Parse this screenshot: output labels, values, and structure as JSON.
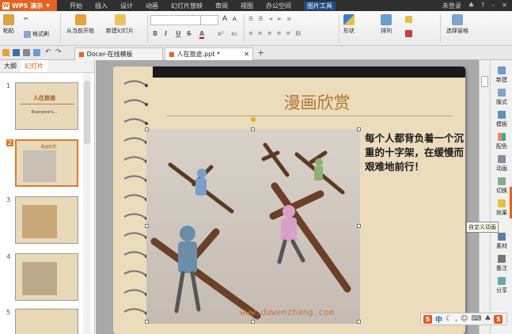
{
  "app": {
    "name": "WPS 演示"
  },
  "menu": [
    "开始",
    "插入",
    "设计",
    "动画",
    "幻灯片放映",
    "审阅",
    "视图",
    "办公空间",
    "图片工具"
  ],
  "menu_active": "图片工具",
  "login": "未登录",
  "ribbon": {
    "paste": "粘贴",
    "format_painter": "格式刷",
    "from_current": "从当前开始",
    "new_slide": "新建幻灯片",
    "shape": "形状",
    "arrange": "排列",
    "select_pane": "选择窗格"
  },
  "tabs": [
    {
      "label": "Docer-在线模板"
    },
    {
      "label": "人在旅途.ppt *"
    }
  ],
  "left_pane": {
    "tabs": [
      "大纲",
      "幻灯片"
    ],
    "active_tab": "幻灯片",
    "slides": [
      {
        "num": "1",
        "title": "人在旅途",
        "subtitle": "Everyone's..."
      },
      {
        "num": "2",
        "title": "漫画欣赏"
      },
      {
        "num": "3"
      },
      {
        "num": "4"
      },
      {
        "num": "5"
      }
    ]
  },
  "slide": {
    "title": "漫画欣赏",
    "caption": "每个人都背负着一个沉重的十字架，在缓慢而艰难地前行！",
    "watermark": "www.duwenzhang.com"
  },
  "right_panel": [
    "新建",
    "版式",
    "模板",
    "配色",
    "动画",
    "切换",
    "效果",
    "素材",
    "备注",
    "分享"
  ],
  "tooltip": "自定义动画",
  "ime": {
    "lang": "中"
  },
  "colors": {
    "accent": "#e6621e",
    "title": "#b07535",
    "slide_bg": "#ebdcbc"
  }
}
